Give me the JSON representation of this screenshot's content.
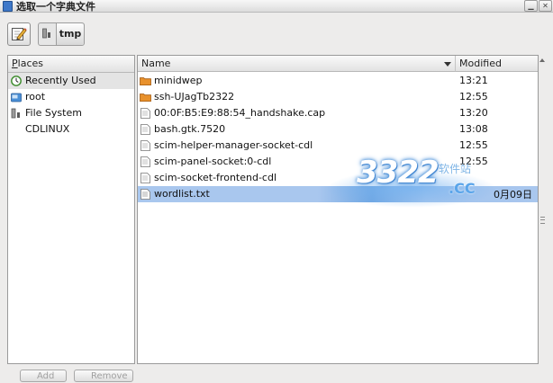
{
  "window": {
    "title": "选取一个字典文件",
    "buttons": [
      "minimize",
      "close"
    ]
  },
  "toolbar": {
    "edit_icon": "pencil-icon",
    "path_segment": "tmp"
  },
  "places": {
    "header": "Places",
    "header_mnemonic": "P",
    "header_rest": "laces",
    "items": [
      {
        "label": "Recently Used",
        "icon": "recent-icon"
      },
      {
        "label": "root",
        "icon": "home-folder-icon"
      },
      {
        "label": "File System",
        "icon": "drive-icon"
      },
      {
        "label": "CDLINUX",
        "icon": ""
      }
    ],
    "add_label": "Add",
    "remove_label": "Remove"
  },
  "files": {
    "columns": {
      "name": "Name",
      "modified": "Modified"
    },
    "rows": [
      {
        "name": "minidwep",
        "modified": "13:21",
        "type": "folder"
      },
      {
        "name": "ssh-UJagTb2322",
        "modified": "12:55",
        "type": "folder"
      },
      {
        "name": "00:0F:B5:E9:88:54_handshake.cap",
        "modified": "13:20",
        "type": "file"
      },
      {
        "name": "bash.gtk.7520",
        "modified": "13:08",
        "type": "file"
      },
      {
        "name": "scim-helper-manager-socket-cdl",
        "modified": "12:55",
        "type": "file"
      },
      {
        "name": "scim-panel-socket:0-cdl",
        "modified": "12:55",
        "type": "file"
      },
      {
        "name": "scim-socket-frontend-cdl",
        "modified": "",
        "type": "file"
      },
      {
        "name": "wordlist.txt",
        "modified": "0月09日",
        "type": "text-file",
        "selected": true
      }
    ]
  },
  "watermark": {
    "number": "3322",
    "domain": ".CC",
    "chinese": "软件站"
  },
  "colors": {
    "selection": "#a9c7ee",
    "folder": "#e8912c",
    "accent": "#4a90d9"
  }
}
